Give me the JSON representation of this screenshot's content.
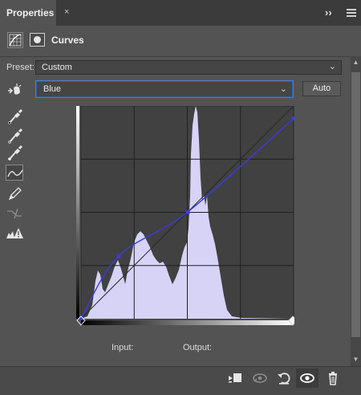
{
  "tabs": [
    {
      "label": "Properties",
      "active": true
    }
  ],
  "tab_close_symbol": "×",
  "collapse_symbol": "››",
  "header": {
    "title": "Curves",
    "icons": [
      "curves-adjustment-icon",
      "layer-mask-icon"
    ]
  },
  "preset": {
    "label": "Preset:",
    "value": "Custom"
  },
  "channel": {
    "value": "Blue",
    "options_visible": [
      "Blue"
    ]
  },
  "auto_label": "Auto",
  "tools": [
    "on-image-adjust-icon",
    "black-point-eyedropper-icon",
    "gray-point-eyedropper-icon",
    "white-point-eyedropper-icon",
    "curve-points-icon",
    "pencil-draw-icon",
    "smooth-curve-icon",
    "clipping-warning-icon"
  ],
  "curve": {
    "channel_color": "#3b3bdc",
    "histogram_color": "#d6d3f7",
    "points_input_output": [
      [
        0,
        0
      ],
      [
        45,
        75
      ],
      [
        128,
        128
      ],
      [
        255,
        240
      ]
    ]
  },
  "labels": {
    "input": "Input:",
    "output": "Output:"
  },
  "bottom_icons": [
    "clip-to-layer-icon",
    "view-previous-state-icon",
    "reset-icon",
    "toggle-visibility-icon",
    "delete-icon"
  ],
  "colors": {
    "panel_bg": "#535353",
    "graph_bg": "#414141",
    "accent_focus": "#4a7fcf"
  }
}
